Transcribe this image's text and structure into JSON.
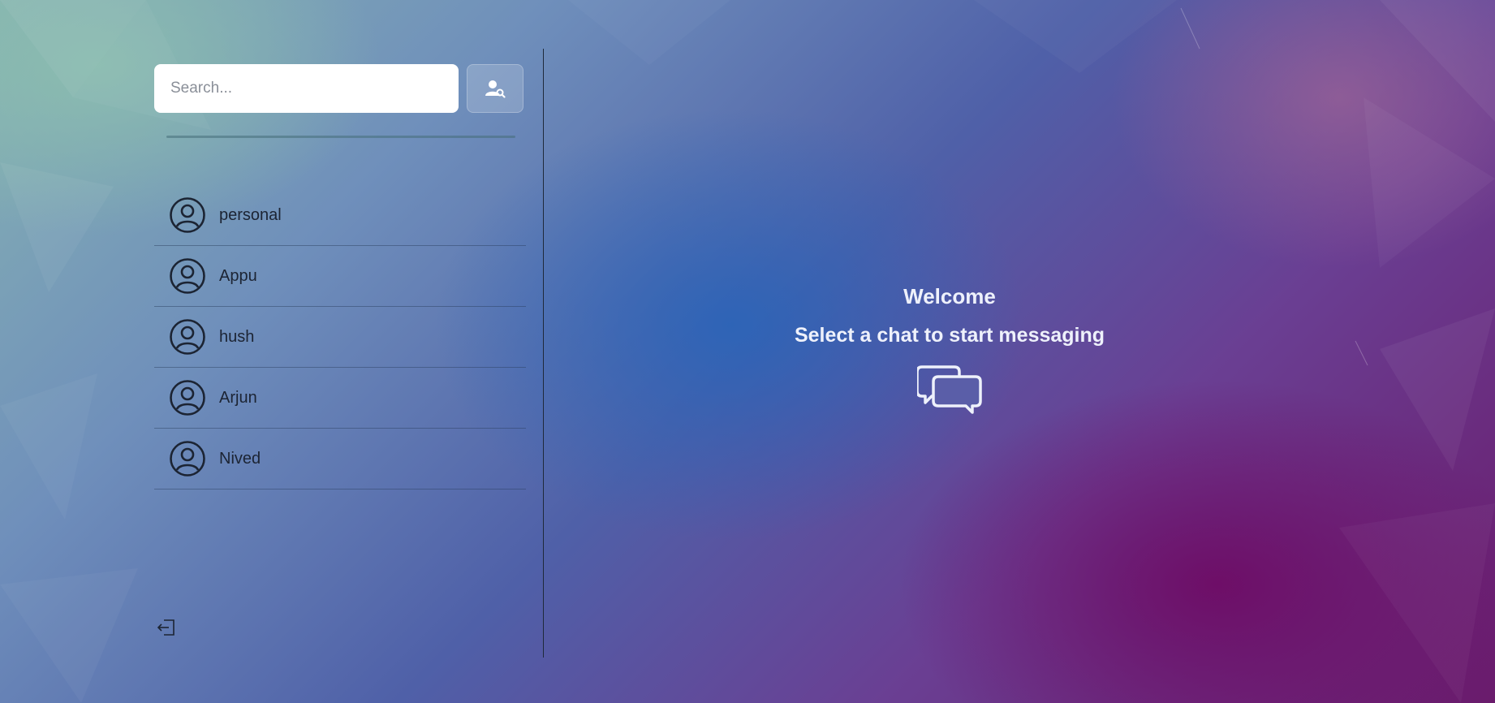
{
  "search": {
    "placeholder": "Search...",
    "button_icon": "user-search-icon"
  },
  "chats": [
    {
      "name": "personal",
      "icon": "user-circle-icon"
    },
    {
      "name": "Appu",
      "icon": "user-circle-icon"
    },
    {
      "name": "hush",
      "icon": "user-circle-icon"
    },
    {
      "name": "Arjun",
      "icon": "user-circle-icon"
    },
    {
      "name": "Nived",
      "icon": "user-circle-icon"
    }
  ],
  "sidebar": {
    "logout_icon": "logout-icon"
  },
  "welcome": {
    "title": "Welcome",
    "subtitle": "Select a chat to start messaging",
    "icon": "chat-bubbles-icon"
  },
  "colors": {
    "text_dark": "#1c2433",
    "text_light": "#eef1fb",
    "input_bg": "#ffffff"
  }
}
